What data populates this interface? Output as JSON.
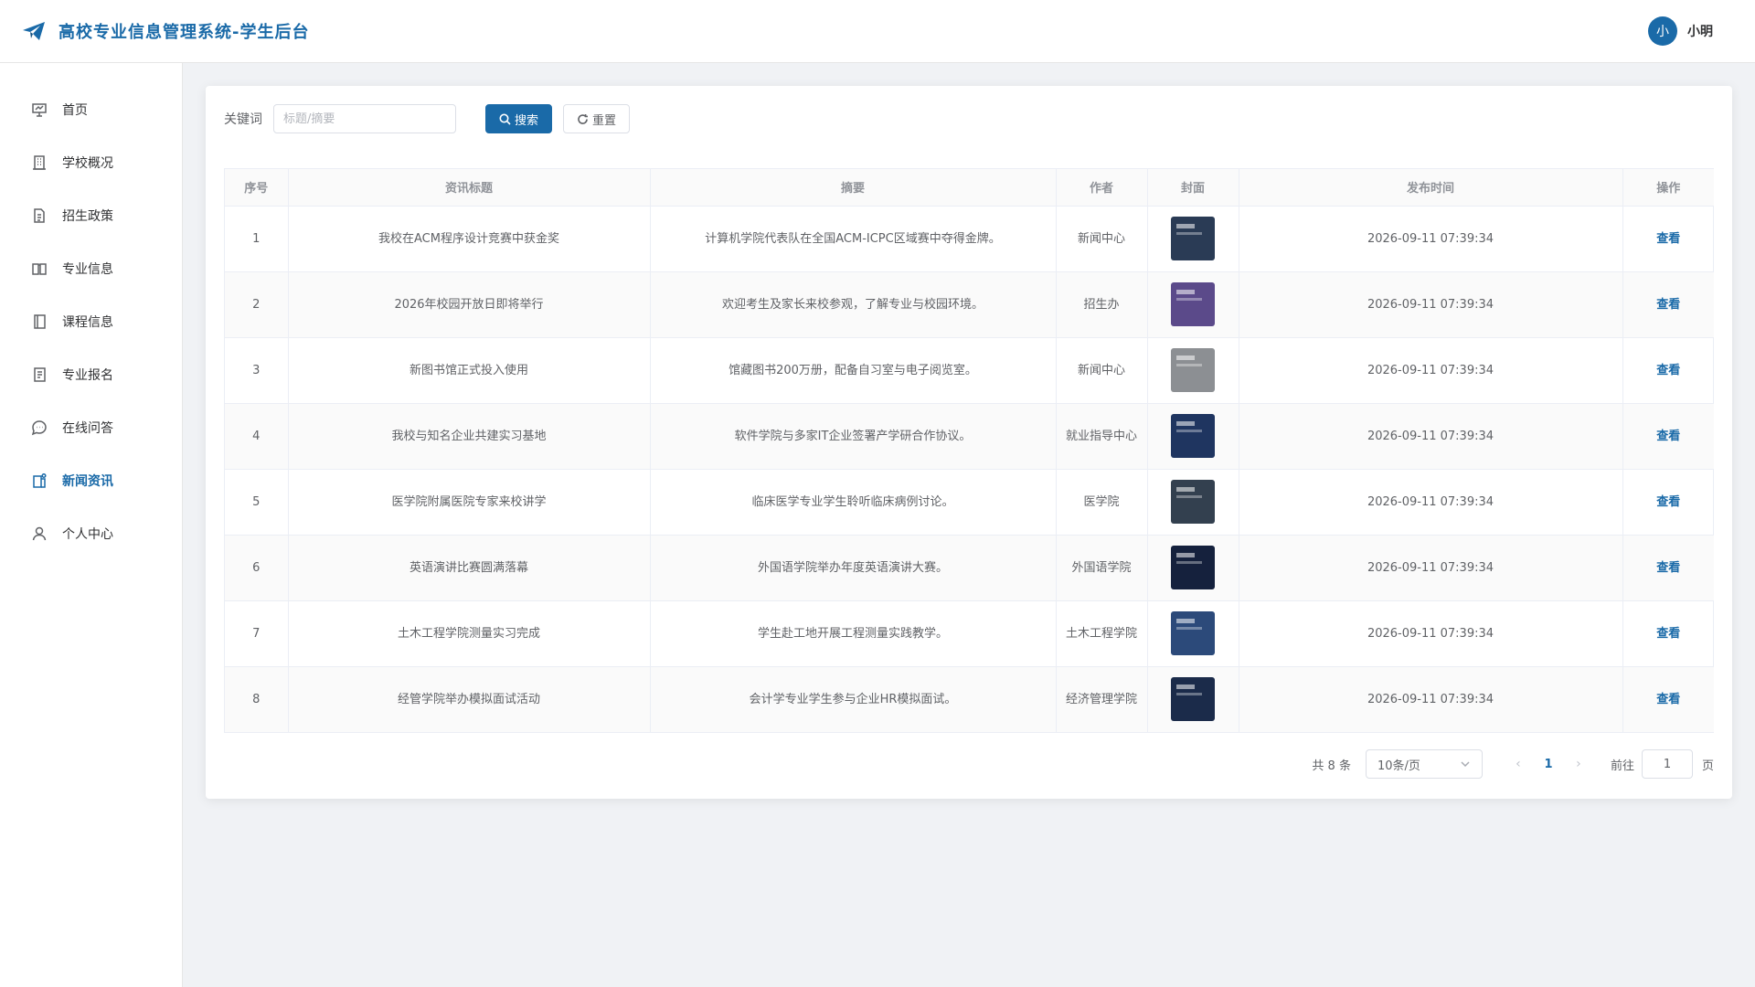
{
  "header": {
    "title": "高校专业信息管理系统-学生后台",
    "avatar_text": "小",
    "user_name": "小明",
    "accent_color": "#1a6aa8"
  },
  "sidebar": {
    "items": [
      {
        "label": "首页",
        "icon": "presentation-icon"
      },
      {
        "label": "学校概况",
        "icon": "building-icon"
      },
      {
        "label": "招生政策",
        "icon": "document-icon"
      },
      {
        "label": "专业信息",
        "icon": "book-icon"
      },
      {
        "label": "课程信息",
        "icon": "notebook-icon"
      },
      {
        "label": "专业报名",
        "icon": "form-icon"
      },
      {
        "label": "在线问答",
        "icon": "chat-icon"
      },
      {
        "label": "新闻资讯",
        "icon": "news-icon",
        "active": true
      },
      {
        "label": "个人中心",
        "icon": "user-icon"
      }
    ]
  },
  "search": {
    "keyword_label": "关键词",
    "placeholder": "标题/摘要",
    "value": "",
    "search_label": "搜索",
    "reset_label": "重置"
  },
  "table": {
    "columns": [
      "序号",
      "资讯标题",
      "摘要",
      "作者",
      "封面",
      "发布时间",
      "操作"
    ],
    "rows": [
      {
        "no": "1",
        "title": "我校在ACM程序设计竞赛中获金奖",
        "summary": "计算机学院代表队在全国ACM-ICPC区域赛中夺得金牌。",
        "author": "新闻中心",
        "time": "2026-09-11 07:39:34",
        "action": "查看",
        "cover_color": "#2a3b55"
      },
      {
        "no": "2",
        "title": "2026年校园开放日即将举行",
        "summary": "欢迎考生及家长来校参观，了解专业与校园环境。",
        "author": "招生办",
        "time": "2026-09-11 07:39:34",
        "action": "查看",
        "cover_color": "#5b4a8a"
      },
      {
        "no": "3",
        "title": "新图书馆正式投入使用",
        "summary": "馆藏图书200万册，配备自习室与电子阅览室。",
        "author": "新闻中心",
        "time": "2026-09-11 07:39:34",
        "action": "查看",
        "cover_color": "#8c8f93"
      },
      {
        "no": "4",
        "title": "我校与知名企业共建实习基地",
        "summary": "软件学院与多家IT企业签署产学研合作协议。",
        "author": "就业指导中心",
        "time": "2026-09-11 07:39:34",
        "action": "查看",
        "cover_color": "#1f3560"
      },
      {
        "no": "5",
        "title": "医学院附属医院专家来校讲学",
        "summary": "临床医学专业学生聆听临床病例讨论。",
        "author": "医学院",
        "time": "2026-09-11 07:39:34",
        "action": "查看",
        "cover_color": "#33404f"
      },
      {
        "no": "6",
        "title": "英语演讲比赛圆满落幕",
        "summary": "外国语学院举办年度英语演讲大赛。",
        "author": "外国语学院",
        "time": "2026-09-11 07:39:34",
        "action": "查看",
        "cover_color": "#15213d"
      },
      {
        "no": "7",
        "title": "土木工程学院测量实习完成",
        "summary": "学生赴工地开展工程测量实践教学。",
        "author": "土木工程学院",
        "time": "2026-09-11 07:39:34",
        "action": "查看",
        "cover_color": "#2c4a7a"
      },
      {
        "no": "8",
        "title": "经管学院举办模拟面试活动",
        "summary": "会计学专业学生参与企业HR模拟面试。",
        "author": "经济管理学院",
        "time": "2026-09-11 07:39:34",
        "action": "查看",
        "cover_color": "#1b2b4a"
      }
    ]
  },
  "pagination": {
    "total_text": "共 8 条",
    "page_size": "10条/页",
    "current_page": "1",
    "goto_label": "前往",
    "goto_value": "1",
    "goto_suffix": "页"
  }
}
